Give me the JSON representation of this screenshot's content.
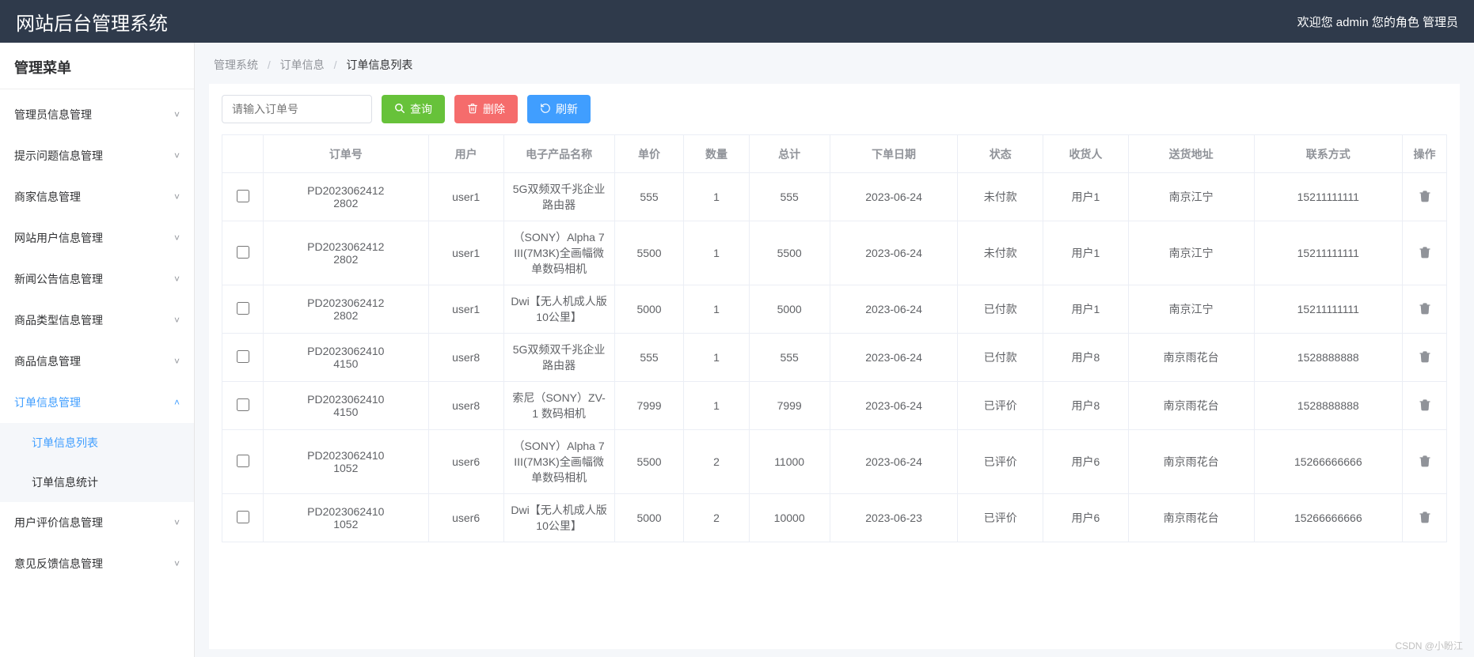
{
  "header": {
    "title": "网站后台管理系统",
    "welcome": "欢迎您 admin 您的角色 管理员"
  },
  "sidebar": {
    "heading": "管理菜单",
    "items": [
      {
        "label": "管理员信息管理",
        "open": false
      },
      {
        "label": "提示问题信息管理",
        "open": false
      },
      {
        "label": "商家信息管理",
        "open": false
      },
      {
        "label": "网站用户信息管理",
        "open": false
      },
      {
        "label": "新闻公告信息管理",
        "open": false
      },
      {
        "label": "商品类型信息管理",
        "open": false
      },
      {
        "label": "商品信息管理",
        "open": false
      },
      {
        "label": "订单信息管理",
        "open": true
      },
      {
        "label": "用户评价信息管理",
        "open": false
      },
      {
        "label": "意见反馈信息管理",
        "open": false
      }
    ],
    "submenu": [
      {
        "label": "订单信息列表"
      },
      {
        "label": "订单信息统计"
      }
    ]
  },
  "breadcrumb": {
    "a": "管理系统",
    "b": "订单信息",
    "c": "订单信息列表"
  },
  "toolbar": {
    "search_placeholder": "请输入订单号",
    "query": "查询",
    "delete": "删除",
    "refresh": "刷新"
  },
  "table": {
    "headers": {
      "order_no": "订单号",
      "user": "用户",
      "product": "电子产品名称",
      "price": "单价",
      "qty": "数量",
      "total": "总计",
      "date": "下单日期",
      "status": "状态",
      "receiver": "收货人",
      "address": "送货地址",
      "phone": "联系方式",
      "op": "操作"
    },
    "rows": [
      {
        "order_no": "PD2023062412\n2802",
        "user": "user1",
        "product": "5G双频双千兆企业路由器",
        "price": "555",
        "qty": "1",
        "total": "555",
        "date": "2023-06-24",
        "status": "未付款",
        "receiver": "用户1",
        "address": "南京江宁",
        "phone": "15211111111"
      },
      {
        "order_no": "PD2023062412\n2802",
        "user": "user1",
        "product": "（SONY）Alpha 7 III(7M3K)全画幅微单数码相机",
        "price": "5500",
        "qty": "1",
        "total": "5500",
        "date": "2023-06-24",
        "status": "未付款",
        "receiver": "用户1",
        "address": "南京江宁",
        "phone": "15211111111"
      },
      {
        "order_no": "PD2023062412\n2802",
        "user": "user1",
        "product": "Dwi【无人机成人版10公里】",
        "price": "5000",
        "qty": "1",
        "total": "5000",
        "date": "2023-06-24",
        "status": "已付款",
        "receiver": "用户1",
        "address": "南京江宁",
        "phone": "15211111111"
      },
      {
        "order_no": "PD2023062410\n4150",
        "user": "user8",
        "product": "5G双频双千兆企业路由器",
        "price": "555",
        "qty": "1",
        "total": "555",
        "date": "2023-06-24",
        "status": "已付款",
        "receiver": "用户8",
        "address": "南京雨花台",
        "phone": "1528888888"
      },
      {
        "order_no": "PD2023062410\n4150",
        "user": "user8",
        "product": "索尼（SONY）ZV-1 数码相机",
        "price": "7999",
        "qty": "1",
        "total": "7999",
        "date": "2023-06-24",
        "status": "已评价",
        "receiver": "用户8",
        "address": "南京雨花台",
        "phone": "1528888888"
      },
      {
        "order_no": "PD2023062410\n1052",
        "user": "user6",
        "product": "（SONY）Alpha 7 III(7M3K)全画幅微单数码相机",
        "price": "5500",
        "qty": "2",
        "total": "11000",
        "date": "2023-06-24",
        "status": "已评价",
        "receiver": "用户6",
        "address": "南京雨花台",
        "phone": "15266666666"
      },
      {
        "order_no": "PD2023062410\n1052",
        "user": "user6",
        "product": "Dwi【无人机成人版10公里】",
        "price": "5000",
        "qty": "2",
        "total": "10000",
        "date": "2023-06-23",
        "status": "已评价",
        "receiver": "用户6",
        "address": "南京雨花台",
        "phone": "15266666666"
      }
    ]
  },
  "watermark": "CSDN @小盼江"
}
